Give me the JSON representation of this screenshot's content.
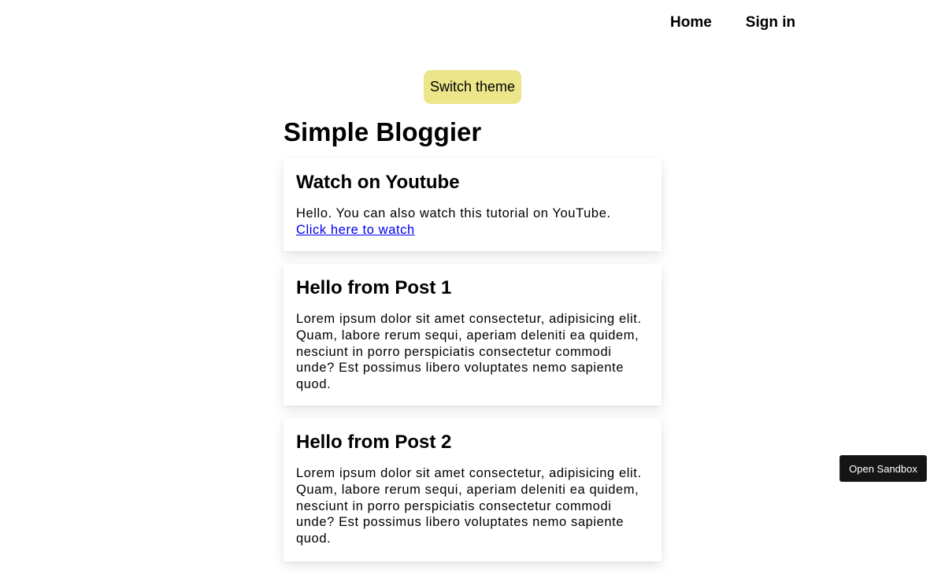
{
  "nav": {
    "items": [
      {
        "label": "Home"
      },
      {
        "label": "Sign in"
      }
    ]
  },
  "theme_button": {
    "label": "Switch theme"
  },
  "site": {
    "title": "Simple Bloggier"
  },
  "posts": [
    {
      "title": "Watch on Youtube",
      "body": "Hello. You can also watch this tutorial on YouTube.",
      "link_text": "Click here to watch"
    },
    {
      "title": "Hello from Post 1",
      "body": "Lorem ipsum dolor sit amet consectetur, adipisicing elit. Quam, labore rerum sequi, aperiam deleniti ea quidem, nesciunt in porro perspiciatis consectetur commodi unde? Est possimus libero voluptates nemo sapiente quod."
    },
    {
      "title": "Hello from Post 2",
      "body": "Lorem ipsum dolor sit amet consectetur, adipisicing elit. Quam, labore rerum sequi, aperiam deleniti ea quidem, nesciunt in porro perspiciatis consectetur commodi unde? Est possimus libero voluptates nemo sapiente quod."
    }
  ],
  "sandbox_button": {
    "label": "Open Sandbox"
  },
  "colors": {
    "theme_button_bg": "#ece58a",
    "link": "#0000ee",
    "sandbox_bg": "#151515"
  }
}
